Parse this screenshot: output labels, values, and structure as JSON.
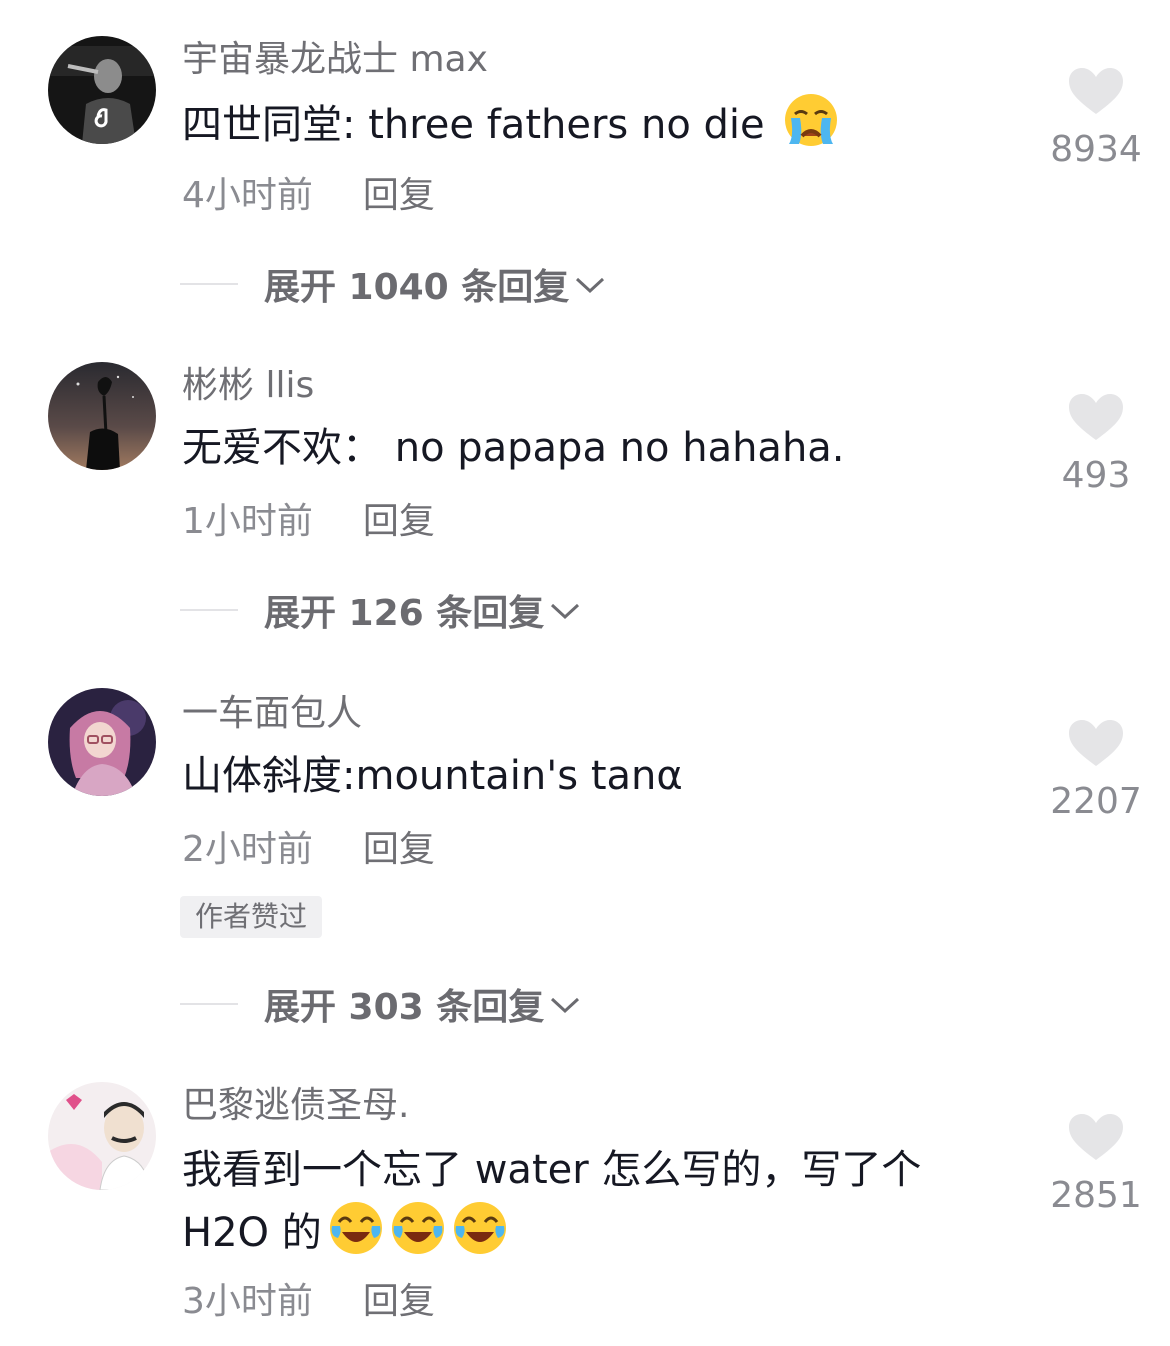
{
  "comments": [
    {
      "username": "宇宙暴龙战士 max",
      "text": "四世同堂: three fathers no die",
      "emoji": [
        "crying-emoji"
      ],
      "time": "4小时前",
      "reply_label": "回复",
      "likes": "8934",
      "expand_label": "展开 1040 条回复"
    },
    {
      "username": "彬彬 llis",
      "text": "无爱不欢： no papapa no hahaha.",
      "emoji": [],
      "time": "1小时前",
      "reply_label": "回复",
      "likes": "493",
      "expand_label": "展开 126 条回复"
    },
    {
      "username": "一车面包人",
      "text": "山体斜度:mountain's tanα",
      "emoji": [],
      "time": "2小时前",
      "reply_label": "回复",
      "likes": "2207",
      "badge": "作者赞过",
      "expand_label": "展开 303 条回复"
    },
    {
      "username": "巴黎逃债圣母.",
      "text": "我看到一个忘了 water 怎么写的，写了个 H2O 的",
      "emoji": [
        "tears-of-joy-emoji",
        "tears-of-joy-emoji",
        "tears-of-joy-emoji"
      ],
      "time": "3小时前",
      "reply_label": "回复",
      "likes": "2851"
    }
  ],
  "colors": {
    "text": "#161823",
    "secondary": "#8a8b91",
    "heart": "#e5e5e7",
    "badge_bg": "#f0f0f2"
  }
}
